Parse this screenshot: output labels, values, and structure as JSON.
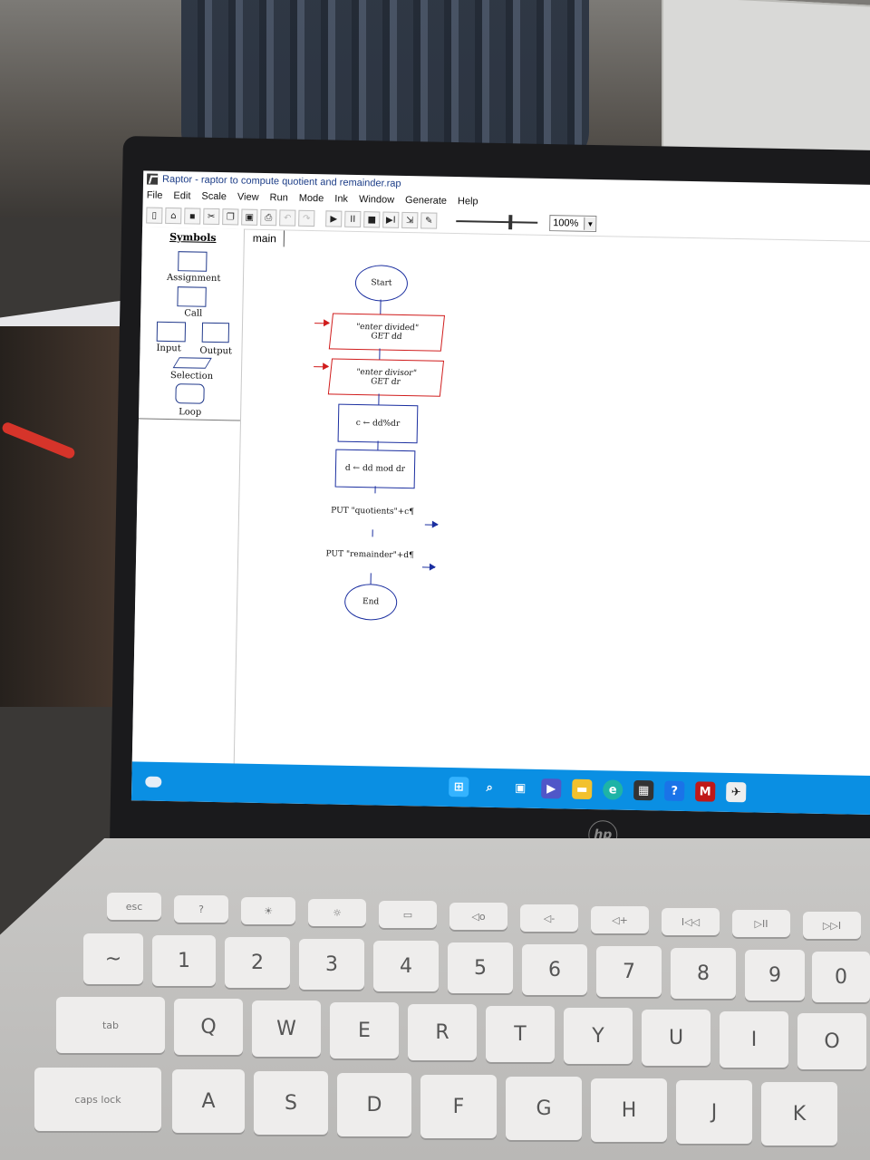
{
  "window": {
    "title": "Raptor - raptor to compute quotient and remainder.rap"
  },
  "menu": [
    "File",
    "Edit",
    "Scale",
    "View",
    "Run",
    "Mode",
    "Ink",
    "Window",
    "Generate",
    "Help"
  ],
  "toolbar": {
    "zoom_value": "100%",
    "play_icon": "▶",
    "pause_icon": "II",
    "stop_icon": "■",
    "step_icon": "▶I"
  },
  "symbols": {
    "heading": "Symbols",
    "assignment": "Assignment",
    "call": "Call",
    "input": "Input",
    "output": "Output",
    "selection": "Selection",
    "loop": "Loop"
  },
  "tabs": {
    "main": "main"
  },
  "flowchart": {
    "start": "Start",
    "input1_prompt": "\"enter divided\"",
    "input1_get": "GET dd",
    "input2_prompt": "\"enter divisor\"",
    "input2_get": "GET dr",
    "assign1": "c ← dd%dr",
    "assign2": "d ← dd mod dr",
    "output1": "PUT \"quotients\"+c¶",
    "output2": "PUT \"remainder\"+d¶",
    "end": "End"
  },
  "taskbar": {
    "icons": [
      "windows-start-icon",
      "search-icon",
      "task-view-icon",
      "teams-icon",
      "file-explorer-icon",
      "edge-icon",
      "store-icon",
      "help-icon",
      "mcafee-icon",
      "raptor-icon"
    ]
  },
  "keyboard": {
    "row0": [
      "esc",
      "?",
      "☀",
      "☼",
      "▭",
      "◁o",
      "◁-",
      "◁+",
      "I◁◁",
      "▷II",
      "▷▷I"
    ],
    "row1": [
      "~",
      "1",
      "2",
      "3",
      "4",
      "5",
      "6",
      "7",
      "8",
      "9",
      "0"
    ],
    "row1_shift": [
      "",
      "!",
      "@",
      "#",
      "$",
      "%",
      "^",
      "&",
      "*",
      "(",
      ")"
    ],
    "row2": [
      "tab",
      "Q",
      "W",
      "E",
      "R",
      "T",
      "Y",
      "U",
      "I",
      "O"
    ],
    "row3": [
      "caps lock",
      "A",
      "S",
      "D",
      "F",
      "G",
      "H",
      "J",
      "K"
    ]
  },
  "brand": "hp"
}
